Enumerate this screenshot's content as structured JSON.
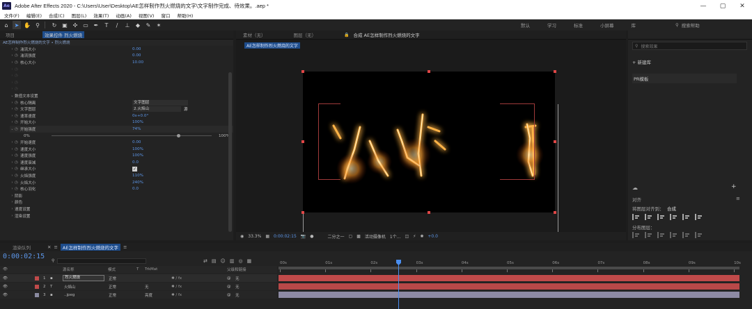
{
  "window": {
    "title": "Adobe After Effects 2020 - C:\\Users\\User\\Desktop\\AE怎样制作烈火燃烧的文字\\文字制作完成、待效果。.aep *",
    "logo": "Ae",
    "controls": [
      "—",
      "▢",
      "✕"
    ]
  },
  "menu": [
    "文件(F)",
    "编辑(E)",
    "合成(C)",
    "图层(L)",
    "效果(T)",
    "动画(A)",
    "视图(V)",
    "窗口",
    "帮助(H)"
  ],
  "toolbar": {
    "workspaces": [
      "默认",
      "学习",
      "标准",
      "小屏幕",
      "库"
    ],
    "help_search": "搜索帮助"
  },
  "effects_panel": {
    "tabs": [
      "项目",
      "效果控件 烈火燃烧"
    ],
    "subtitle": "AE怎样制作烈火燃烧的文字 • 烈火燃烧",
    "rows": [
      {
        "label": "湍流大小",
        "value": "0.00"
      },
      {
        "label": "湍流强度",
        "value": "0.00"
      },
      {
        "label": "核心大小",
        "value": "10.00"
      },
      {
        "label": "",
        "value": ""
      },
      {
        "label": "",
        "value": ""
      },
      {
        "label": "",
        "value": ""
      },
      {
        "label": "",
        "value": ""
      },
      {
        "label": "数值文本设置",
        "value": ""
      },
      {
        "label": "核心隔离",
        "value": "文字图层"
      },
      {
        "label": "文字图层",
        "value": "2.火焰山",
        "extra": "源"
      },
      {
        "label": "速率速度",
        "value": "0x+0.0°"
      },
      {
        "label": "开始大小",
        "value": "100%"
      },
      {
        "label": "开始强度",
        "value": "74%"
      },
      {
        "label": "0%",
        "value": "",
        "extra": "100%"
      },
      {
        "label": "开始速度",
        "value": "0.00"
      },
      {
        "label": "速度大小",
        "value": "100%"
      },
      {
        "label": "速度强度",
        "value": "100%"
      },
      {
        "label": "速度衰减",
        "value": "0.0"
      },
      {
        "label": "继承大小",
        "value": ""
      },
      {
        "label": "火焰强度",
        "value": "110%"
      },
      {
        "label": "火焰大小",
        "value": "240%"
      },
      {
        "label": "核心羽化",
        "value": "0.0"
      },
      {
        "label": "阴影",
        "value": ""
      },
      {
        "label": "颜色",
        "value": ""
      },
      {
        "label": "速度设置",
        "value": ""
      },
      {
        "label": "渲染设置",
        "value": ""
      }
    ]
  },
  "comp_panel": {
    "tabs": [
      "素材（无）",
      "图层（无）",
      "合成 AE怎样制作烈火燃烧的文字"
    ],
    "subtab": "AE怎样制作烈火燃烧的文字",
    "viewer_bar": {
      "zoom": "33.3%",
      "time": "0:00:02:15",
      "resolution": "二分之一",
      "camera": "活动摄像机",
      "views": "1个...",
      "exposure": "+0.0"
    }
  },
  "right_panel": {
    "search_placeholder": "搜索效果",
    "new_preset": "新建库",
    "preset_item": "PR模板",
    "align_title": "对齐",
    "align_to_label": "将图层对齐到：",
    "align_to_value": "合成",
    "distribute_label": "分布图层："
  },
  "timeline": {
    "tabs": [
      "渲染队列",
      "AE怎样制作烈火燃烧的文字"
    ],
    "timecode": "0:00:02:15",
    "columns": [
      "源名称",
      "模式",
      "T",
      "TrkMat",
      "父级和链接"
    ],
    "ruler": [
      "00s",
      "01s",
      "02s",
      "03s",
      "04s",
      "05s",
      "06s",
      "07s",
      "08s",
      "09s",
      "10s"
    ],
    "layers": [
      {
        "num": "1",
        "name": "烈火燃烧",
        "mode": "正常",
        "trkmat": "",
        "parent": "无",
        "color": "#c04a4a",
        "bar": "#c04a4a"
      },
      {
        "num": "2",
        "name": "火焰山",
        "mode": "正常",
        "trkmat": "无",
        "parent": "无",
        "color": "#c04a4a",
        "bar": "#b84848"
      },
      {
        "num": "3",
        "name": "..jpeg",
        "mode": "正常",
        "trkmat": "亮度",
        "parent": "无",
        "color": "#8a8aa0",
        "bar": "#8d8aa4"
      }
    ]
  },
  "colors": {
    "accent": "#5c96e8",
    "bg": "#1d1d1d",
    "layer_red": "#c04a4a",
    "layer_lilac": "#8d8aa4"
  }
}
